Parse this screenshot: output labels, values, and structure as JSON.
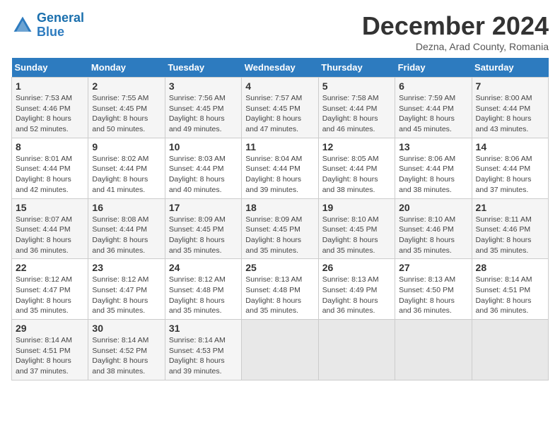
{
  "header": {
    "logo_line1": "General",
    "logo_line2": "Blue",
    "month_title": "December 2024",
    "subtitle": "Dezna, Arad County, Romania"
  },
  "days_of_week": [
    "Sunday",
    "Monday",
    "Tuesday",
    "Wednesday",
    "Thursday",
    "Friday",
    "Saturday"
  ],
  "weeks": [
    [
      {
        "day": "1",
        "sunrise": "7:53 AM",
        "sunset": "4:46 PM",
        "daylight": "8 hours and 52 minutes."
      },
      {
        "day": "2",
        "sunrise": "7:55 AM",
        "sunset": "4:45 PM",
        "daylight": "8 hours and 50 minutes."
      },
      {
        "day": "3",
        "sunrise": "7:56 AM",
        "sunset": "4:45 PM",
        "daylight": "8 hours and 49 minutes."
      },
      {
        "day": "4",
        "sunrise": "7:57 AM",
        "sunset": "4:45 PM",
        "daylight": "8 hours and 47 minutes."
      },
      {
        "day": "5",
        "sunrise": "7:58 AM",
        "sunset": "4:44 PM",
        "daylight": "8 hours and 46 minutes."
      },
      {
        "day": "6",
        "sunrise": "7:59 AM",
        "sunset": "4:44 PM",
        "daylight": "8 hours and 45 minutes."
      },
      {
        "day": "7",
        "sunrise": "8:00 AM",
        "sunset": "4:44 PM",
        "daylight": "8 hours and 43 minutes."
      }
    ],
    [
      {
        "day": "8",
        "sunrise": "8:01 AM",
        "sunset": "4:44 PM",
        "daylight": "8 hours and 42 minutes."
      },
      {
        "day": "9",
        "sunrise": "8:02 AM",
        "sunset": "4:44 PM",
        "daylight": "8 hours and 41 minutes."
      },
      {
        "day": "10",
        "sunrise": "8:03 AM",
        "sunset": "4:44 PM",
        "daylight": "8 hours and 40 minutes."
      },
      {
        "day": "11",
        "sunrise": "8:04 AM",
        "sunset": "4:44 PM",
        "daylight": "8 hours and 39 minutes."
      },
      {
        "day": "12",
        "sunrise": "8:05 AM",
        "sunset": "4:44 PM",
        "daylight": "8 hours and 38 minutes."
      },
      {
        "day": "13",
        "sunrise": "8:06 AM",
        "sunset": "4:44 PM",
        "daylight": "8 hours and 38 minutes."
      },
      {
        "day": "14",
        "sunrise": "8:06 AM",
        "sunset": "4:44 PM",
        "daylight": "8 hours and 37 minutes."
      }
    ],
    [
      {
        "day": "15",
        "sunrise": "8:07 AM",
        "sunset": "4:44 PM",
        "daylight": "8 hours and 36 minutes."
      },
      {
        "day": "16",
        "sunrise": "8:08 AM",
        "sunset": "4:44 PM",
        "daylight": "8 hours and 36 minutes."
      },
      {
        "day": "17",
        "sunrise": "8:09 AM",
        "sunset": "4:45 PM",
        "daylight": "8 hours and 35 minutes."
      },
      {
        "day": "18",
        "sunrise": "8:09 AM",
        "sunset": "4:45 PM",
        "daylight": "8 hours and 35 minutes."
      },
      {
        "day": "19",
        "sunrise": "8:10 AM",
        "sunset": "4:45 PM",
        "daylight": "8 hours and 35 minutes."
      },
      {
        "day": "20",
        "sunrise": "8:10 AM",
        "sunset": "4:46 PM",
        "daylight": "8 hours and 35 minutes."
      },
      {
        "day": "21",
        "sunrise": "8:11 AM",
        "sunset": "4:46 PM",
        "daylight": "8 hours and 35 minutes."
      }
    ],
    [
      {
        "day": "22",
        "sunrise": "8:12 AM",
        "sunset": "4:47 PM",
        "daylight": "8 hours and 35 minutes."
      },
      {
        "day": "23",
        "sunrise": "8:12 AM",
        "sunset": "4:47 PM",
        "daylight": "8 hours and 35 minutes."
      },
      {
        "day": "24",
        "sunrise": "8:12 AM",
        "sunset": "4:48 PM",
        "daylight": "8 hours and 35 minutes."
      },
      {
        "day": "25",
        "sunrise": "8:13 AM",
        "sunset": "4:48 PM",
        "daylight": "8 hours and 35 minutes."
      },
      {
        "day": "26",
        "sunrise": "8:13 AM",
        "sunset": "4:49 PM",
        "daylight": "8 hours and 36 minutes."
      },
      {
        "day": "27",
        "sunrise": "8:13 AM",
        "sunset": "4:50 PM",
        "daylight": "8 hours and 36 minutes."
      },
      {
        "day": "28",
        "sunrise": "8:14 AM",
        "sunset": "4:51 PM",
        "daylight": "8 hours and 36 minutes."
      }
    ],
    [
      {
        "day": "29",
        "sunrise": "8:14 AM",
        "sunset": "4:51 PM",
        "daylight": "8 hours and 37 minutes."
      },
      {
        "day": "30",
        "sunrise": "8:14 AM",
        "sunset": "4:52 PM",
        "daylight": "8 hours and 38 minutes."
      },
      {
        "day": "31",
        "sunrise": "8:14 AM",
        "sunset": "4:53 PM",
        "daylight": "8 hours and 39 minutes."
      },
      null,
      null,
      null,
      null
    ]
  ]
}
